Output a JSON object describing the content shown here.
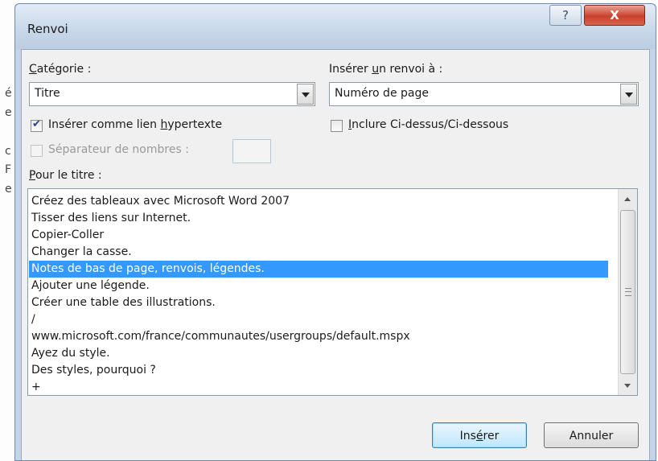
{
  "background_fragments": [
    "é",
    "e",
    "c",
    "F",
    "e"
  ],
  "window": {
    "title": "Renvoi",
    "help_glyph": "?",
    "close_glyph": "X"
  },
  "category": {
    "label_prefix": "",
    "label_hotkey": "C",
    "label_rest": "atégorie :",
    "value": "Titre"
  },
  "insert_ref": {
    "label_prefix": "Insérer ",
    "label_hotkey": "u",
    "label_rest": "n renvoi à :",
    "value": "Numéro de page"
  },
  "hyperlink_checkbox": {
    "label_prefix": "Insérer comme lien ",
    "label_hotkey": "h",
    "label_rest": "ypertexte",
    "checked": true
  },
  "above_below_checkbox": {
    "label_prefix": "",
    "label_hotkey": "I",
    "label_rest": "nclure Ci-dessus/Ci-dessous",
    "checked": false
  },
  "separator_checkbox": {
    "label": "Séparateur de nombres :",
    "checked": false,
    "enabled": false
  },
  "for_title": {
    "label_prefix": "",
    "label_hotkey": "P",
    "label_rest": "our le titre :"
  },
  "headings": [
    "Créez des tableaux avec Microsoft Word 2007",
    "Tisser des liens sur Internet.",
    "Copier-Coller",
    "Changer la casse.",
    "Notes de bas de page, renvois, légendes.",
    "Ajouter une légende.",
    "Créer une table des illustrations.",
    "/",
    "www.microsoft.com/france/communautes/usergroups/default.mspx",
    "Ayez du style.",
    "Des styles, pourquoi ?",
    "+"
  ],
  "selected_index": 4,
  "buttons": {
    "insert_prefix": "Ins",
    "insert_hotkey": "é",
    "insert_rest": "rer",
    "cancel": "Annuler"
  },
  "colors": {
    "selection": "#3399ff",
    "title_bar": "#c9d8ea",
    "close_button": "#c8412c"
  }
}
